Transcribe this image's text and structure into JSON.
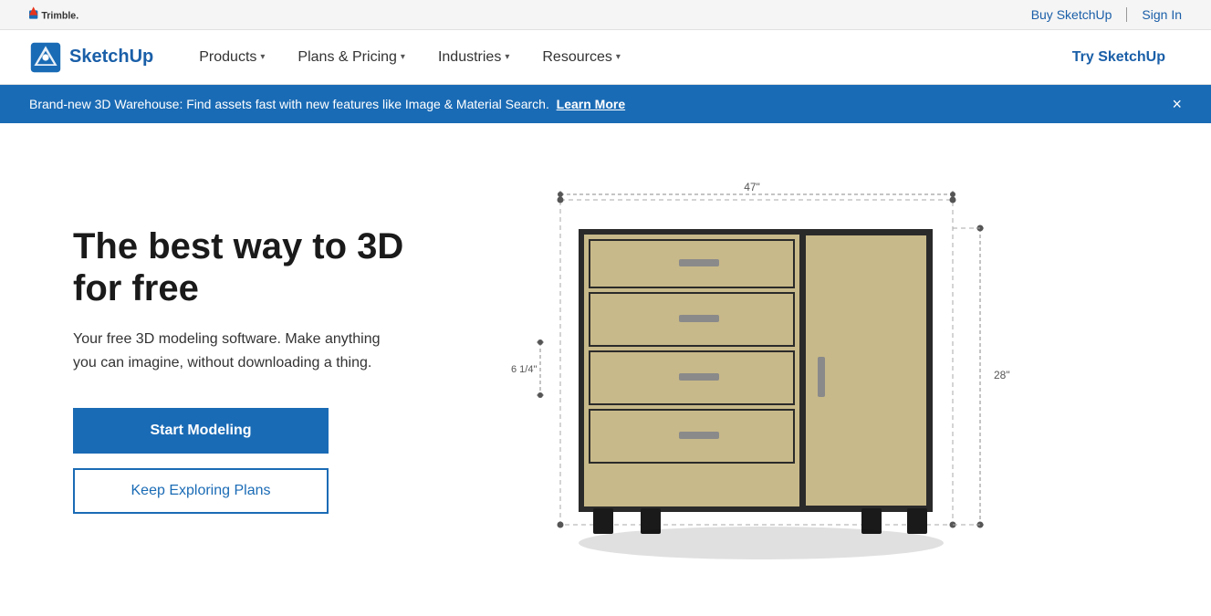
{
  "topbar": {
    "buy_label": "Buy SketchUp",
    "signin_label": "Sign In"
  },
  "nav": {
    "logo_text": "SketchUp",
    "links": [
      {
        "label": "Products",
        "has_chevron": true
      },
      {
        "label": "Plans & Pricing",
        "has_chevron": true
      },
      {
        "label": "Industries",
        "has_chevron": true
      },
      {
        "label": "Resources",
        "has_chevron": true
      }
    ],
    "cta_label": "Try SketchUp"
  },
  "banner": {
    "text": "Brand-new 3D Warehouse: Find assets fast with new features like Image & Material Search. ",
    "link_text": "Learn More",
    "close_label": "×"
  },
  "hero": {
    "title": "The best way to 3D for free",
    "subtitle": "Your free 3D modeling software. Make anything you can imagine, without downloading a thing.",
    "btn_primary": "Start Modeling",
    "btn_secondary": "Keep Exploring Plans"
  },
  "dimensions": {
    "width_label": "47\"",
    "height_label": "6 1/4\"",
    "depth_label": "28\""
  }
}
